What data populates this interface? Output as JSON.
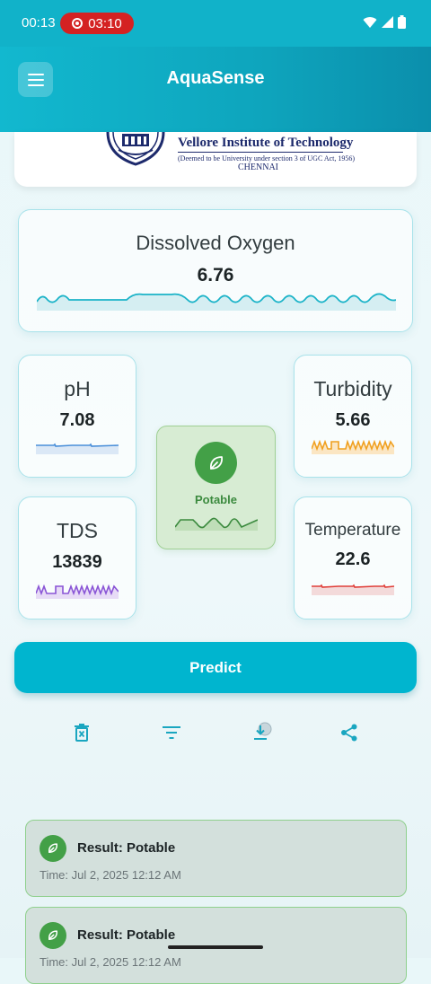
{
  "status_bar": {
    "time": "00:13",
    "recording_timer": "03:10"
  },
  "app_bar": {
    "title": "AquaSense"
  },
  "logo": {
    "institution": "Vellore Institute of Technology",
    "subtitle": "(Deemed to be University under section 3 of UGC Act, 1956)",
    "city": "CHENNAI"
  },
  "sensors": {
    "dissolved_oxygen": {
      "label": "Dissolved Oxygen",
      "value": "6.76",
      "color": "#1bb3c8"
    },
    "ph": {
      "label": "pH",
      "value": "7.08",
      "color": "#4a8fd9"
    },
    "turbidity": {
      "label": "Turbidity",
      "value": "5.66",
      "color": "#f0a020"
    },
    "tds": {
      "label": "TDS",
      "value": "13839",
      "color": "#8a55d6"
    },
    "temperature": {
      "label": "Temperature",
      "value": "22.6",
      "color": "#e0403a"
    }
  },
  "prediction": {
    "label": "Potable",
    "color": "#43a047"
  },
  "predict_button": {
    "label": "Predict"
  },
  "actions": [
    "delete-icon",
    "filter-icon",
    "download-icon",
    "share-icon"
  ],
  "history": [
    {
      "result": "Result: Potable",
      "time": "Time: Jul 2, 2025 12:12 AM"
    },
    {
      "result": "Result: Potable",
      "time": "Time: Jul 2, 2025 12:12 AM"
    }
  ]
}
